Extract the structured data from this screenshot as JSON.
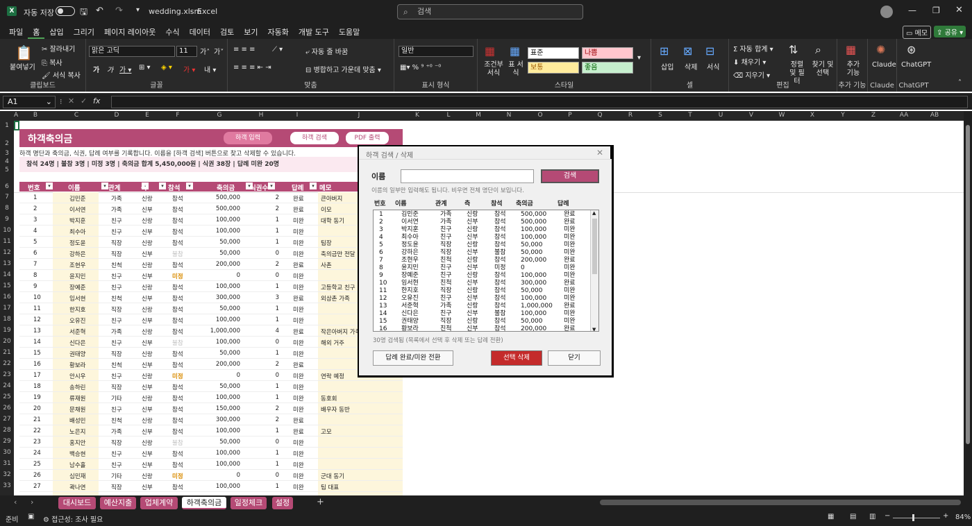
{
  "titlebar": {
    "autosave_label": "자동 저장",
    "filename": "wedding.xlsm",
    "app": "Excel",
    "search_placeholder": "검색"
  },
  "menu": [
    "파일",
    "홈",
    "삽입",
    "그리기",
    "페이지 레이아웃",
    "수식",
    "데이터",
    "검토",
    "보기",
    "자동화",
    "개발 도구",
    "도움말"
  ],
  "menu_right": {
    "comment": "메모",
    "share": "공유"
  },
  "ribbon": {
    "clipboard": {
      "paste": "붙여넣기",
      "cut": "잘라내기",
      "copy": "복사",
      "format_painter": "서식 복사",
      "label": "클립보드"
    },
    "font": {
      "name": "맑은 고딕",
      "size": "11",
      "label": "글꼴"
    },
    "align": {
      "wrap": "자동 줄 바꿈",
      "merge": "병합하고 가운데 맞춤",
      "label": "맞춤"
    },
    "number": {
      "format": "일반",
      "label": "표시 형식"
    },
    "styles": {
      "cond": "조건부 서식",
      "table": "표 서식",
      "normal": "표준",
      "bad": "나쁨",
      "neutral": "보통",
      "good": "좋음",
      "label": "스타일"
    },
    "cells": {
      "insert": "삽입",
      "delete": "삭제",
      "format": "서식",
      "label": "셀"
    },
    "editing": {
      "autosum": "자동 합계",
      "fill": "채우기",
      "clear": "지우기",
      "sort": "정렬 및 필터",
      "find": "찾기 및 선택",
      "label": "편집"
    },
    "addins": {
      "add": "추가 기능",
      "label": "추가 기능"
    },
    "claude": {
      "name": "Claude",
      "label": "Claude"
    },
    "chatgpt": {
      "name": "ChatGPT",
      "label": "ChatGPT"
    }
  },
  "formula_bar": {
    "cell_ref": "A1",
    "fx": "fx"
  },
  "columns": [
    "A",
    "B",
    "C",
    "D",
    "E",
    "F",
    "G",
    "H",
    "I",
    "J",
    "K",
    "L",
    "M",
    "N",
    "O",
    "P",
    "Q",
    "R",
    "S",
    "T",
    "U",
    "V",
    "W",
    "X",
    "Y",
    "Z",
    "AA",
    "AB"
  ],
  "rows": [
    "1",
    "2",
    "3",
    "4",
    "5",
    "6",
    "7",
    "8",
    "9",
    "10",
    "11",
    "12",
    "13",
    "14",
    "15",
    "16",
    "17",
    "18",
    "19",
    "20",
    "21",
    "22",
    "23",
    "24",
    "25",
    "26",
    "27",
    "28",
    "29",
    "30",
    "31",
    "32",
    "33"
  ],
  "sheet": {
    "title": "하객축의금",
    "btn_input": "하객 입력",
    "btn_search": "하객 검색",
    "btn_pdf": "PDF 출력",
    "note": "하객 명단과 축의금, 식권, 답례 여부를 기록합니다. 이름을 [하객 검색] 버튼으로 찾고 삭제할 수 있습니다.",
    "summary": "참석 24명   |   불참 3명   |   미정 3명   |   축의금 합계 5,450,000원   |   식권 38장   |   답례 미완 20명",
    "headers": [
      "번호",
      "이름",
      "관계",
      "측",
      "참석",
      "축의금",
      "식권수",
      "답례",
      "메모"
    ],
    "rows": [
      [
        "1",
        "김민준",
        "가족",
        "신랑",
        "참석",
        "500,000",
        "2",
        "완료",
        "큰아버지"
      ],
      [
        "2",
        "이서연",
        "가족",
        "신부",
        "참석",
        "500,000",
        "2",
        "완료",
        "이모"
      ],
      [
        "3",
        "박지훈",
        "친구",
        "신랑",
        "참석",
        "100,000",
        "1",
        "미완",
        "대학 동기"
      ],
      [
        "4",
        "최수아",
        "친구",
        "신부",
        "참석",
        "100,000",
        "1",
        "미완",
        ""
      ],
      [
        "5",
        "정도윤",
        "직장",
        "신랑",
        "참석",
        "50,000",
        "1",
        "미완",
        "팀장"
      ],
      [
        "6",
        "강하은",
        "직장",
        "신부",
        "불참",
        "50,000",
        "0",
        "미완",
        "축의금만 전달"
      ],
      [
        "7",
        "조현우",
        "친척",
        "신랑",
        "참석",
        "200,000",
        "2",
        "완료",
        "사촌"
      ],
      [
        "8",
        "윤지민",
        "친구",
        "신부",
        "미정",
        "0",
        "0",
        "미완",
        ""
      ],
      [
        "9",
        "장예준",
        "친구",
        "신랑",
        "참석",
        "100,000",
        "1",
        "미완",
        "고등학교 친구"
      ],
      [
        "10",
        "임서현",
        "친척",
        "신부",
        "참석",
        "300,000",
        "3",
        "완료",
        "외삼촌 가족"
      ],
      [
        "11",
        "한지호",
        "직장",
        "신랑",
        "참석",
        "50,000",
        "1",
        "미완",
        ""
      ],
      [
        "12",
        "오유진",
        "친구",
        "신부",
        "참석",
        "100,000",
        "1",
        "미완",
        ""
      ],
      [
        "13",
        "서준혁",
        "가족",
        "신랑",
        "참석",
        "1,000,000",
        "4",
        "완료",
        "작은아버지 가족"
      ],
      [
        "14",
        "신다은",
        "친구",
        "신부",
        "불참",
        "100,000",
        "0",
        "미완",
        "해외 거주"
      ],
      [
        "15",
        "권태양",
        "직장",
        "신랑",
        "참석",
        "50,000",
        "1",
        "미완",
        ""
      ],
      [
        "16",
        "황보라",
        "친척",
        "신부",
        "참석",
        "200,000",
        "2",
        "완료",
        ""
      ],
      [
        "17",
        "안시우",
        "친구",
        "신랑",
        "미정",
        "0",
        "0",
        "미완",
        "연락 예정"
      ],
      [
        "18",
        "송하린",
        "직장",
        "신부",
        "참석",
        "50,000",
        "1",
        "미완",
        ""
      ],
      [
        "19",
        "류재원",
        "기타",
        "신랑",
        "참석",
        "100,000",
        "1",
        "미완",
        "동호회"
      ],
      [
        "20",
        "문채원",
        "친구",
        "신부",
        "참석",
        "150,000",
        "2",
        "미완",
        "배우자 동반"
      ],
      [
        "21",
        "배성민",
        "친척",
        "신랑",
        "참석",
        "300,000",
        "2",
        "완료",
        ""
      ],
      [
        "22",
        "노은지",
        "가족",
        "신부",
        "참석",
        "100,000",
        "1",
        "완료",
        "고모"
      ],
      [
        "23",
        "홍지안",
        "직장",
        "신랑",
        "불참",
        "50,000",
        "0",
        "미완",
        ""
      ],
      [
        "24",
        "백승현",
        "친구",
        "신부",
        "참석",
        "100,000",
        "1",
        "미완",
        ""
      ],
      [
        "25",
        "남수홀",
        "친구",
        "신부",
        "참석",
        "100,000",
        "1",
        "미완",
        ""
      ],
      [
        "26",
        "심민재",
        "기타",
        "신랑",
        "미정",
        "0",
        "0",
        "미완",
        "군대 동기"
      ],
      [
        "27",
        "곽나연",
        "직장",
        "신부",
        "참석",
        "100,000",
        "1",
        "미완",
        "팀 대표"
      ]
    ]
  },
  "dialog": {
    "title": "하객 검색 / 삭제",
    "name_label": "이름",
    "name_value": "",
    "search_btn": "검색",
    "hint": "이름의 일부만 입력해도 됩니다. 비우면 전체 명단이 보입니다.",
    "list_headers": [
      "번호",
      "이름",
      "관계",
      "측",
      "참석",
      "축의금",
      "답례"
    ],
    "list_rows": [
      [
        "1",
        "김민준",
        "가족",
        "신랑",
        "참석",
        "500,000",
        "완료"
      ],
      [
        "2",
        "이서연",
        "가족",
        "신부",
        "참석",
        "500,000",
        "완료"
      ],
      [
        "3",
        "박지훈",
        "친구",
        "신랑",
        "참석",
        "100,000",
        "미완"
      ],
      [
        "4",
        "최수아",
        "친구",
        "신부",
        "참석",
        "100,000",
        "미완"
      ],
      [
        "5",
        "정도윤",
        "직장",
        "신랑",
        "참석",
        "50,000",
        "미완"
      ],
      [
        "6",
        "강하은",
        "직장",
        "신부",
        "불참",
        "50,000",
        "미완"
      ],
      [
        "7",
        "조현우",
        "친척",
        "신랑",
        "참석",
        "200,000",
        "완료"
      ],
      [
        "8",
        "윤지민",
        "친구",
        "신부",
        "미정",
        "0",
        "미완"
      ],
      [
        "9",
        "장예준",
        "친구",
        "신랑",
        "참석",
        "100,000",
        "미완"
      ],
      [
        "10",
        "임서현",
        "친척",
        "신부",
        "참석",
        "300,000",
        "완료"
      ],
      [
        "11",
        "한지호",
        "직장",
        "신랑",
        "참석",
        "50,000",
        "미완"
      ],
      [
        "12",
        "오유진",
        "친구",
        "신부",
        "참석",
        "100,000",
        "미완"
      ],
      [
        "13",
        "서준혁",
        "가족",
        "신랑",
        "참석",
        "1,000,000",
        "완료"
      ],
      [
        "14",
        "신다은",
        "친구",
        "신부",
        "불참",
        "100,000",
        "미완"
      ],
      [
        "15",
        "권태양",
        "직장",
        "신랑",
        "참석",
        "50,000",
        "미완"
      ],
      [
        "16",
        "황보라",
        "친척",
        "신부",
        "참석",
        "200,000",
        "완료"
      ]
    ],
    "count_text": "30명 검색됨 (목록에서 선택 후 삭제 또는 답례 전환)",
    "toggle_btn": "답례 완료/미완 전환",
    "delete_btn": "선택 삭제",
    "close_btn": "닫기"
  },
  "tabs": [
    "대시보드",
    "예산지출",
    "업체계약",
    "하객축의금",
    "일정체크",
    "설정"
  ],
  "active_tab": "하객축의금",
  "status": {
    "ready": "준비",
    "accessibility": "접근성: 조사 필요",
    "zoom": "84%"
  },
  "colors": {
    "accent": "#b54a75",
    "tab": "#b54a75",
    "delete": "#c42b2b",
    "cream": "#fdf6dc"
  }
}
